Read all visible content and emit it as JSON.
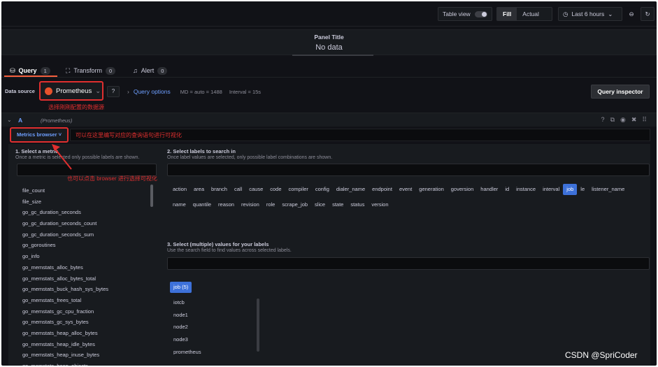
{
  "toolbar": {
    "table_view": "Table view",
    "fill": "Fill",
    "actual": "Actual",
    "time_range": "Last 6 hours"
  },
  "panel": {
    "title": "Panel Title",
    "no_data": "No data"
  },
  "tabs": [
    {
      "label": "Query",
      "count": "1",
      "icon": "database-icon"
    },
    {
      "label": "Transform",
      "count": "0",
      "icon": "transform-icon"
    },
    {
      "label": "Alert",
      "count": "0",
      "icon": "bell-icon"
    }
  ],
  "datasource": {
    "label": "Data source",
    "name": "Prometheus",
    "query_options": "Query options",
    "md": "MD = auto = 1488",
    "interval": "Interval = 15s",
    "inspector": "Query inspector"
  },
  "annotations": {
    "select_ds": "选择刚刚配置的数据源",
    "write_query": "可以在这里编写对应的查询语句进行可视化",
    "click_browser": "也可以点击 browser 进行选择可视化"
  },
  "query": {
    "name": "A",
    "datasource": "(Prometheus)",
    "metrics_browser": "Metrics browser ˅"
  },
  "browser": {
    "step1_title": "1. Select a metric",
    "step1_sub": "Once a metric is selected only possible labels are shown.",
    "metrics": [
      "file_count",
      "file_size",
      "go_gc_duration_seconds",
      "go_gc_duration_seconds_count",
      "go_gc_duration_seconds_sum",
      "go_goroutines",
      "go_info",
      "go_memstats_alloc_bytes",
      "go_memstats_alloc_bytes_total",
      "go_memstats_buck_hash_sys_bytes",
      "go_memstats_frees_total",
      "go_memstats_gc_cpu_fraction",
      "go_memstats_gc_sys_bytes",
      "go_memstats_heap_alloc_bytes",
      "go_memstats_heap_idle_bytes",
      "go_memstats_heap_inuse_bytes",
      "go_memstats_heap_objects"
    ],
    "step2_title": "2. Select labels to search in",
    "step2_sub": "Once label values are selected, only possible label combinations are shown.",
    "labels": [
      "action",
      "area",
      "branch",
      "call",
      "cause",
      "code",
      "compiler",
      "config",
      "dialer_name",
      "endpoint",
      "event",
      "generation",
      "goversion",
      "handler",
      "id",
      "instance",
      "interval",
      "job",
      "le",
      "listener_name",
      "name",
      "quantile",
      "reason",
      "revision",
      "role",
      "scrape_job",
      "slice",
      "state",
      "status",
      "version"
    ],
    "selected_label": "job",
    "step3_title": "3. Select (multiple) values for your labels",
    "step3_sub": "Use the search field to find values across selected labels.",
    "job_chip": "job (5)",
    "values": [
      "iotcb",
      "node1",
      "node2",
      "node3",
      "prometheus"
    ]
  },
  "watermark": "CSDN @SpriCoder",
  "colors": {
    "accent": "#3d71d9",
    "annotation": "#e02f2f",
    "tab_underline": "#f55f3e"
  }
}
